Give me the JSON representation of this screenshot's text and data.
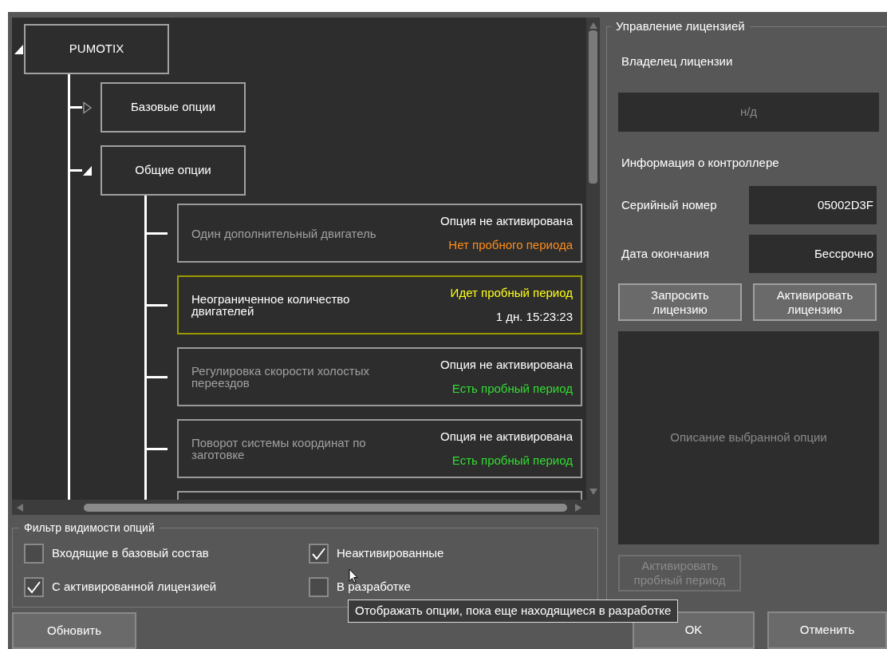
{
  "tree": {
    "kind": "group",
    "label": "PUMOTIX",
    "expanded": true,
    "children": [
      {
        "kind": "group",
        "label": "Базовые опции",
        "expanded": false
      },
      {
        "kind": "group",
        "label": "Общие опции",
        "expanded": true,
        "children": [
          {
            "kind": "option",
            "trial_active": false,
            "title": "Один дополнительный двигатель",
            "lines": [
              {
                "text": "Опция не активирована",
                "color": "#ffffff"
              },
              {
                "text": "Нет пробного периода",
                "color": "#ff8c1a"
              }
            ]
          },
          {
            "kind": "option",
            "trial_active": true,
            "title": "Неограниченное количество двигателей",
            "lines": [
              {
                "text": "Идет пробный период",
                "color": "#ffff1a"
              },
              {
                "text": "1 дн. 15:23:23",
                "color": "#ffffff"
              }
            ]
          },
          {
            "kind": "option",
            "trial_active": false,
            "title": "Регулировка скорости холостых переездов",
            "lines": [
              {
                "text": "Опция не активирована",
                "color": "#ffffff"
              },
              {
                "text": "Есть пробный период",
                "color": "#33dd33"
              }
            ]
          },
          {
            "kind": "option",
            "trial_active": false,
            "title": "Поворот системы координат по заготовке",
            "lines": [
              {
                "text": "Опция не активирована",
                "color": "#ffffff"
              },
              {
                "text": "Есть пробный период",
                "color": "#33dd33"
              }
            ]
          },
          {
            "kind": "option",
            "trial_active": false
          }
        ]
      }
    ]
  },
  "filter": {
    "title": "Фильтр видимости опций",
    "items": [
      {
        "label": "Входящие в базовый состав",
        "checked": false
      },
      {
        "label": "Неактивированные",
        "checked": true
      },
      {
        "label": "С активированной лицензией",
        "checked": true
      },
      {
        "label": "В разработке",
        "checked": false
      }
    ]
  },
  "tooltip": "Отображать опции, пока еще находящиеся в разработке",
  "refresh_button": "Обновить",
  "license": {
    "title": "Управление лицензией",
    "owner_label": "Владелец лицензии",
    "owner_value": "н/д",
    "controller_label": "Информация о контроллере",
    "fields": [
      {
        "label": "Серийный номер",
        "value": "05002D3F"
      },
      {
        "label": "Дата окончания",
        "value": "Бессрочно"
      }
    ],
    "buttons": [
      {
        "label": "Запросить лицензию",
        "disabled": false
      },
      {
        "label": "Активировать лицензию",
        "disabled": false
      }
    ],
    "description_placeholder": "Описание выбранной опции",
    "trial_button": {
      "label": "Активировать пробный период",
      "disabled": true
    }
  },
  "dialog_buttons": [
    "OK",
    "Отменить"
  ]
}
